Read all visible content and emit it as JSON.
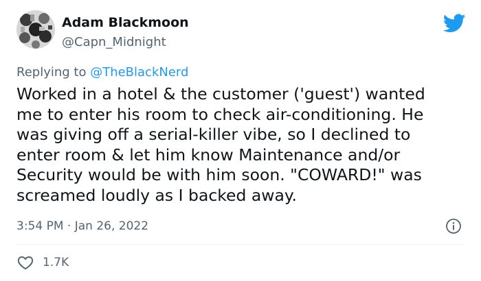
{
  "tweet": {
    "author_name": "Adam Blackmoon",
    "author_handle": "@Capn_Midnight",
    "replying_prefix": "Replying to ",
    "replying_to": "@TheBlackNerd",
    "text": "Worked in a hotel & the customer ('guest') wanted\nme to enter his room to check air-conditioning. He\nwas giving off a serial-killer vibe, so I declined to\nenter room & let him know Maintenance and/or\nSecurity would be with him soon. \"COWARD!\" was\nscreamed loudly as I backed away.",
    "timestamp": "3:54 PM · Jan 26, 2022",
    "likes": "1.7K"
  },
  "icons": {
    "brand": "twitter-bird-icon",
    "info": "info-icon",
    "like": "heart-icon"
  },
  "colors": {
    "brand_blue": "#1d9bf0",
    "text_primary": "#0f1419",
    "text_secondary": "#536471",
    "divider": "#eff3f4"
  }
}
